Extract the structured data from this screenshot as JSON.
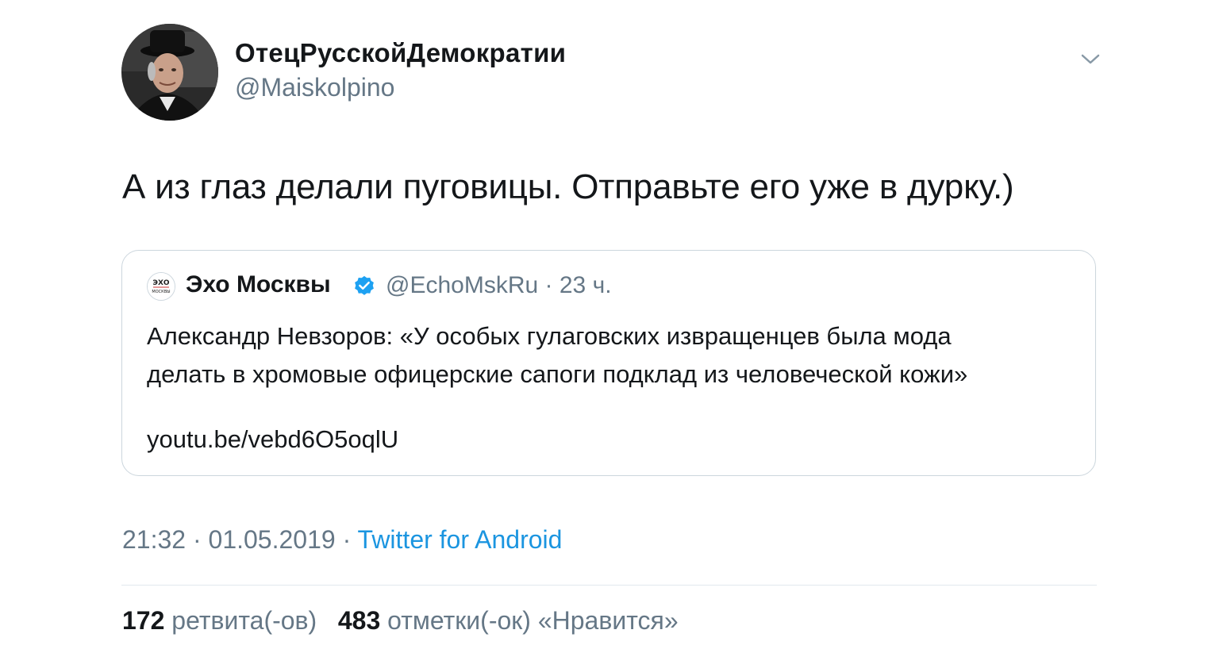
{
  "author": {
    "name": "ОтецРусскойДемократии",
    "handle": "@Maiskolpino"
  },
  "tweet": {
    "text": "А из глаз делали пуговицы. Отправьте его уже в дурку.)"
  },
  "quoted_tweet": {
    "name": "Эхо Москвы",
    "avatar_text_top": "ЭХО",
    "avatar_text_bottom": "МОСКВЫ",
    "handle": "@EchoMskRu",
    "separator": "·",
    "time": "23 ч.",
    "text_line1": "Александр Невзоров: «У особых гулаговских извращенцев была мода",
    "text_line2": "делать в хромовые офицерские сапоги подклад из человеческой кожи»",
    "link": "youtu.be/vebd6O5oqlU"
  },
  "meta": {
    "time": "21:32",
    "separator": "·",
    "date": "01.05.2019",
    "source": "Twitter for Android"
  },
  "stats": {
    "retweets_count": "172",
    "retweets_label": "ретвита(-ов)",
    "likes_count": "483",
    "likes_label": "отметки(-ок) «Нравится»"
  },
  "colors": {
    "link_blue": "#1b95e0",
    "secondary_gray": "#657786",
    "border": "#ccd6dd",
    "verified_blue": "#1da1f2"
  },
  "icons": {
    "caret": "chevron-down-icon",
    "verified": "verified-badge-icon"
  }
}
